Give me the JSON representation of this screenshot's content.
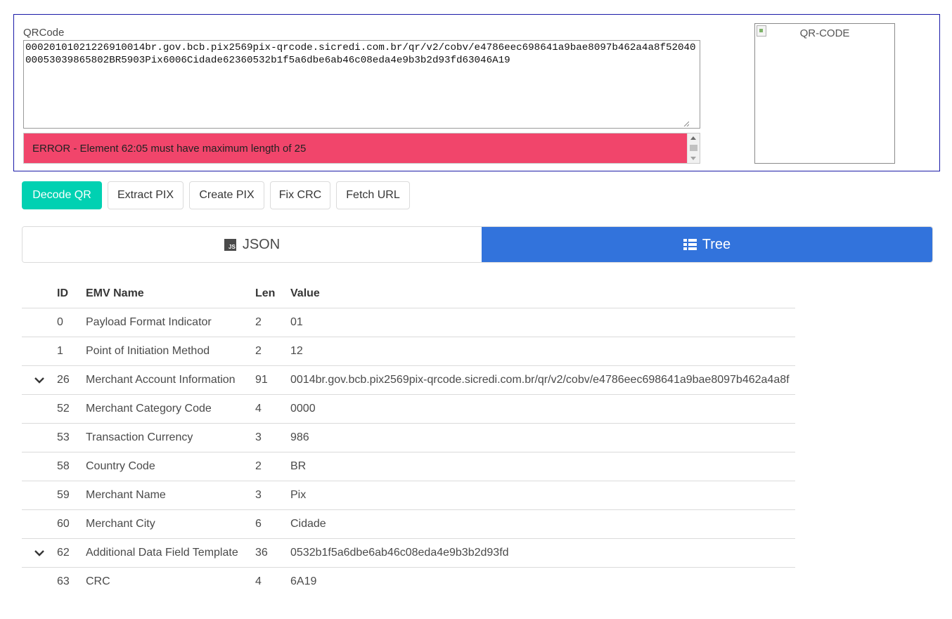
{
  "qrcode": {
    "label": "QRCode",
    "value": "00020101021226910014br.gov.bcb.pix2569pix-qrcode.sicredi.com.br/qr/v2/cobv/e4786eec698641a9bae8097b462a4a8f5204000053039865802BR5903Pix6006Cidade62360532b1f5a6dbe6ab46c08eda4e9b3b2d93fd63046A19",
    "error": "ERROR - Element 62:05 must have maximum length of 25",
    "image_alt": "QR-CODE"
  },
  "buttons": {
    "decode": "Decode QR",
    "extract": "Extract PIX",
    "create": "Create PIX",
    "fix_crc": "Fix CRC",
    "fetch_url": "Fetch URL"
  },
  "tabs": {
    "json": "JSON",
    "tree": "Tree",
    "active": "Tree"
  },
  "table": {
    "headers": {
      "id": "ID",
      "name": "EMV Name",
      "len": "Len",
      "value": "Value"
    },
    "rows": [
      {
        "expandable": false,
        "id": "0",
        "name": "Payload Format Indicator",
        "len": "2",
        "value": "01"
      },
      {
        "expandable": false,
        "id": "1",
        "name": "Point of Initiation Method",
        "len": "2",
        "value": "12"
      },
      {
        "expandable": true,
        "id": "26",
        "name": "Merchant Account Information",
        "len": "91",
        "value": "0014br.gov.bcb.pix2569pix-qrcode.sicredi.com.br/qr/v2/cobv/e4786eec698641a9bae8097b462a4a8f"
      },
      {
        "expandable": false,
        "id": "52",
        "name": "Merchant Category Code",
        "len": "4",
        "value": "0000"
      },
      {
        "expandable": false,
        "id": "53",
        "name": "Transaction Currency",
        "len": "3",
        "value": "986"
      },
      {
        "expandable": false,
        "id": "58",
        "name": "Country Code",
        "len": "2",
        "value": "BR"
      },
      {
        "expandable": false,
        "id": "59",
        "name": "Merchant Name",
        "len": "3",
        "value": "Pix"
      },
      {
        "expandable": false,
        "id": "60",
        "name": "Merchant City",
        "len": "6",
        "value": "Cidade"
      },
      {
        "expandable": true,
        "id": "62",
        "name": "Additional Data Field Template",
        "len": "36",
        "value": "0532b1f5a6dbe6ab46c08eda4e9b3b2d93fd"
      },
      {
        "expandable": false,
        "id": "63",
        "name": "CRC",
        "len": "4",
        "value": "6A19"
      }
    ]
  },
  "icons": {
    "json_tab": "js-icon",
    "tree_tab": "list-icon",
    "row_toggle": "chevron-down-icon",
    "qr_image": "broken-image-icon"
  },
  "colors": {
    "primary_button": "#00d1b2",
    "active_tab": "#3273dc",
    "error_bg": "#f1456b",
    "panel_border": "#1a1aa8"
  }
}
